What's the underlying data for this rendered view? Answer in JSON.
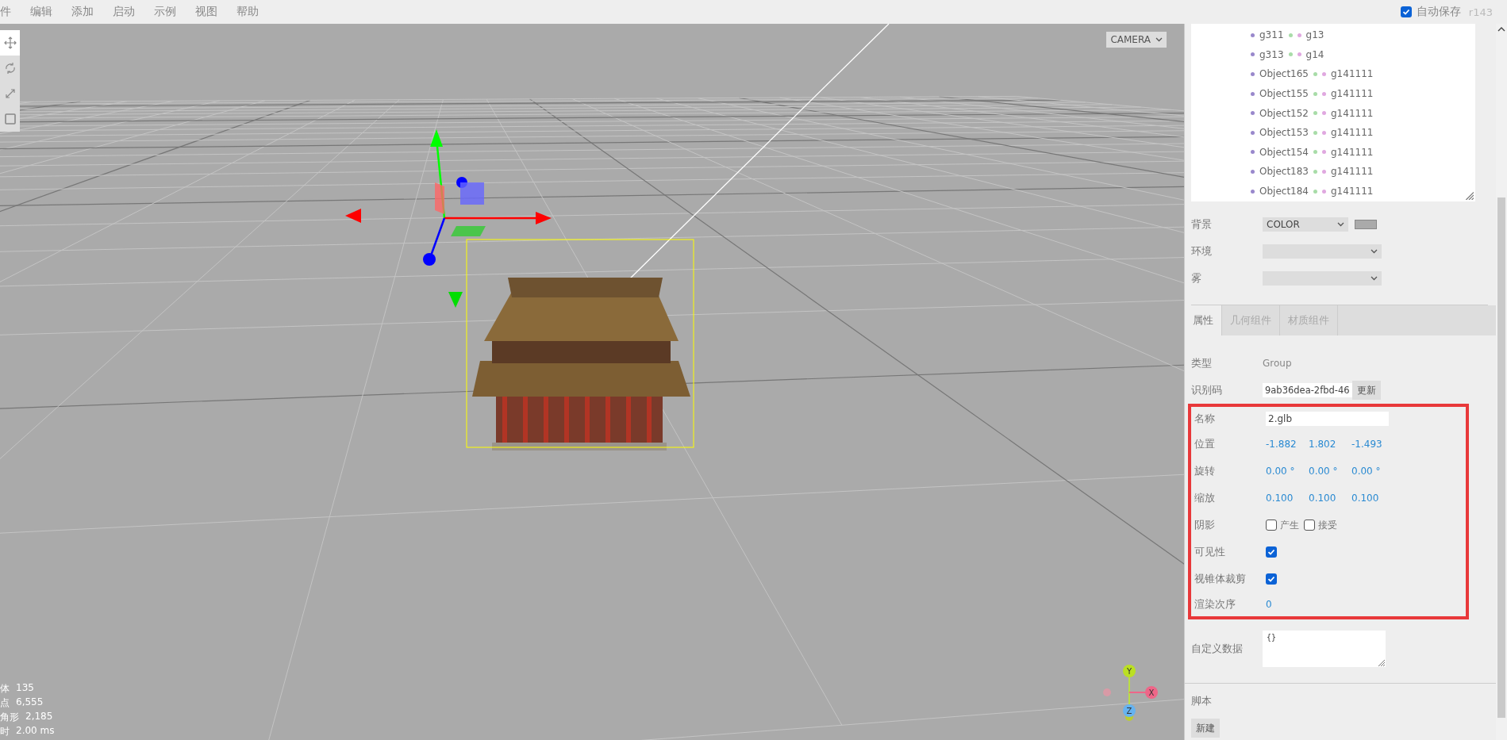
{
  "menubar": {
    "menus": [
      "件",
      "编辑",
      "添加",
      "启动",
      "示例",
      "视图",
      "帮助"
    ],
    "autosave": {
      "label": "自动保存",
      "checked": true
    },
    "version": "r143"
  },
  "toolbar": [
    {
      "kind": "translate",
      "selected": true
    },
    {
      "kind": "rotate",
      "selected": false
    },
    {
      "kind": "scale",
      "selected": false
    },
    {
      "kind": "local",
      "selected": false
    }
  ],
  "viewport": {
    "camera": "CAMERA",
    "axes": [
      "Y",
      "X",
      "Z"
    ],
    "info": [
      {
        "label": "体",
        "value": "135"
      },
      {
        "label": "点",
        "value": "6,555"
      },
      {
        "label": "角形",
        "value": "2,185"
      },
      {
        "label": "时",
        "value": "2.00 ms"
      }
    ]
  },
  "outliner": [
    {
      "object": "g311",
      "material": "g13"
    },
    {
      "object": "g313",
      "material": "g14"
    },
    {
      "object": "Object165",
      "material": "g141111"
    },
    {
      "object": "Object155",
      "material": "g141111"
    },
    {
      "object": "Object152",
      "material": "g141111"
    },
    {
      "object": "Object153",
      "material": "g141111"
    },
    {
      "object": "Object154",
      "material": "g141111"
    },
    {
      "object": "Object183",
      "material": "g141111"
    },
    {
      "object": "Object184",
      "material": "g141111"
    }
  ],
  "scene": [
    {
      "label": "背景",
      "kind": "color-select",
      "value": "COLOR"
    },
    {
      "label": "环境",
      "kind": "select"
    },
    {
      "label": "雾",
      "kind": "select"
    }
  ],
  "tabs": [
    {
      "label": "属性",
      "selected": true
    },
    {
      "label": "几何组件",
      "selected": false
    },
    {
      "label": "材质组件",
      "selected": false
    }
  ],
  "properties": {
    "rows_above": [
      {
        "kind": "text",
        "label": "类型",
        "value": "Group"
      },
      {
        "kind": "uuid",
        "label": "识别码",
        "value": "9ab36dea-2fbd-46",
        "button": "更新"
      }
    ],
    "highlighted_rows": [
      {
        "kind": "input",
        "label": "名称",
        "value": "2.glb"
      },
      {
        "kind": "vector",
        "label": "位置",
        "values": [
          "-1.882",
          "1.802",
          "-1.493"
        ]
      },
      {
        "kind": "vector",
        "label": "旋转",
        "values": [
          "0.00 °",
          "0.00 °",
          "0.00 °"
        ]
      },
      {
        "kind": "vector",
        "label": "缩放",
        "values": [
          "0.100",
          "0.100",
          "0.100"
        ]
      },
      {
        "kind": "checks",
        "label": "阴影",
        "options": [
          {
            "label": "产生",
            "checked": false
          },
          {
            "label": "接受",
            "checked": false
          }
        ]
      },
      {
        "kind": "checkbox",
        "label": "可见性",
        "checked": true
      },
      {
        "kind": "checkbox",
        "label": "视锥体裁剪",
        "checked": true
      },
      {
        "kind": "number",
        "label": "渲染次序",
        "value": "0"
      }
    ],
    "rows_below": [
      {
        "kind": "textarea",
        "label": "自定义数据",
        "value": "{}"
      }
    ]
  },
  "script": {
    "title": "脚本",
    "button": "新建"
  }
}
